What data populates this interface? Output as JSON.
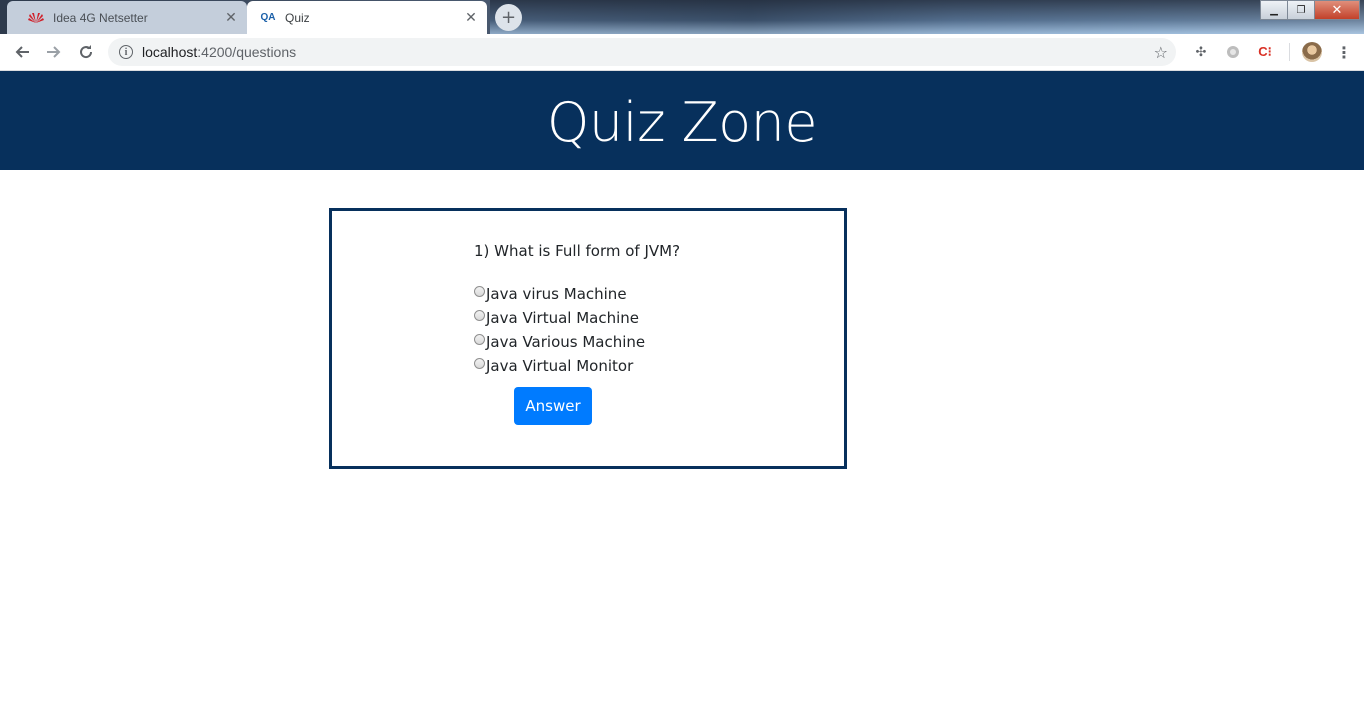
{
  "browser": {
    "tabs": [
      {
        "title": "Idea 4G Netsetter",
        "favicon": "huawei-logo-icon",
        "active": false
      },
      {
        "title": "Quiz",
        "favicon": "qa-logo-icon",
        "active": true
      }
    ],
    "url_host": "localhost",
    "url_path": ":4200/questions"
  },
  "header": {
    "title": "Quiz Zone"
  },
  "quiz": {
    "question": "1) What is Full form of JVM?",
    "options": [
      "Java virus Machine",
      "Java Virtual Machine",
      "Java Various Machine",
      "Java Virtual Monitor"
    ],
    "answer_label": "Answer"
  },
  "colors": {
    "header_bg": "#07305c",
    "button_bg": "#007bff",
    "card_border": "#07305c"
  }
}
